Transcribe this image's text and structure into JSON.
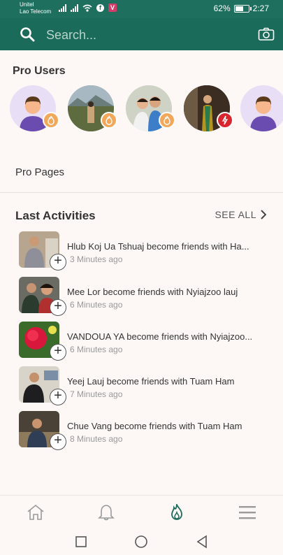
{
  "status_bar": {
    "carrier_1": "Unitel",
    "carrier_2": "Lao Telecom",
    "battery": "62%",
    "battery_level": 0.62,
    "time": "2:27"
  },
  "search": {
    "placeholder": "Search..."
  },
  "pro_users": {
    "title": "Pro Users",
    "users": [
      {
        "type": "placeholder-avatar",
        "badge": "flame-icon"
      },
      {
        "type": "photo",
        "badge": "flame-icon"
      },
      {
        "type": "photo",
        "badge": "flame-icon"
      },
      {
        "type": "photo",
        "badge": "bolt-icon"
      },
      {
        "type": "placeholder-avatar",
        "badge": "flame-icon"
      }
    ]
  },
  "pro_pages": {
    "label": "Pro Pages"
  },
  "last_activities": {
    "title": "Last Activities",
    "see_all": "SEE ALL",
    "items": [
      {
        "text": "Hlub Koj Ua Tshuaj become friends with Ha...",
        "time": "3 Minutes ago"
      },
      {
        "text": "Mee Lor become friends with Nyiajzoo lauj",
        "time": "6 Minutes ago"
      },
      {
        "text": "VANDOUA YA become friends with Nyiajzoo...",
        "time": "6 Minutes ago"
      },
      {
        "text": "Yeej Lauj become friends with Tuam Ham",
        "time": "7 Minutes ago"
      },
      {
        "text": "Chue Vang become friends with Tuam Ham",
        "time": "8 Minutes ago"
      }
    ]
  },
  "bottom_nav": [
    "home-icon",
    "bell-icon",
    "flame-icon",
    "menu-icon"
  ],
  "colors": {
    "accent": "#1b6b5a",
    "badge_orange": "#f2a85b",
    "badge_red": "#d8262e"
  }
}
